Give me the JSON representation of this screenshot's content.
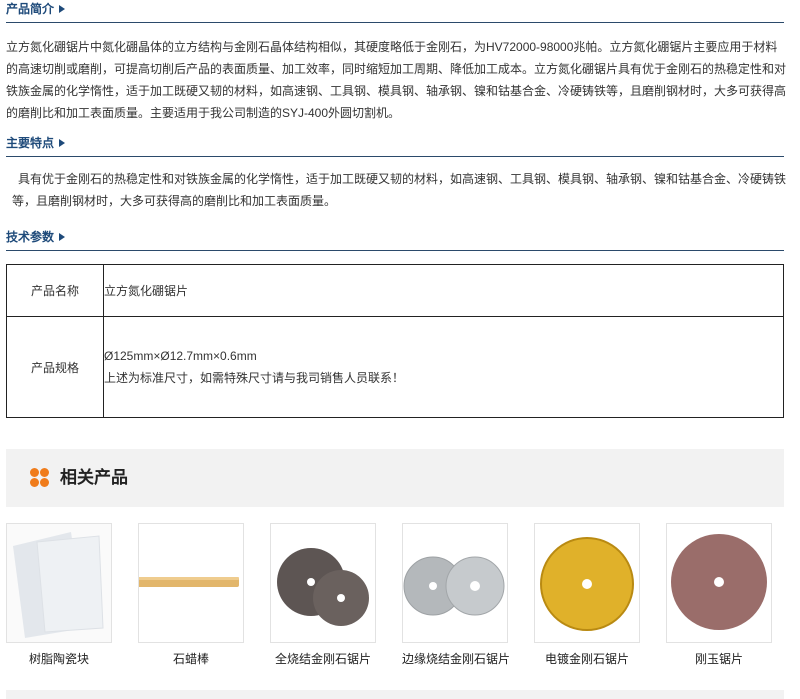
{
  "sections": {
    "intro": {
      "title": "产品简介",
      "text": "立方氮化硼锯片中氮化硼晶体的立方结构与金刚石晶体结构相似，其硬度略低于金刚石，为HV72000-98000兆帕。立方氮化硼锯片主要应用于材料的高速切削或磨削，可提高切削后产品的表面质量、加工效率，同时缩短加工周期、降低加工成本。立方氮化硼锯片具有优于金刚石的热稳定性和对铁族金属的化学惰性，适于加工既硬又韧的材料，如高速钢、工具钢、模具钢、轴承钢、镍和钴基合金、冷硬铸铁等，且磨削钢材时，大多可获得高的磨削比和加工表面质量。主要适用于我公司制造的SYJ-400外圆切割机。"
    },
    "features": {
      "title": "主要特点",
      "text": "具有优于金刚石的热稳定性和对铁族金属的化学惰性，适于加工既硬又韧的材料，如高速钢、工具钢、模具钢、轴承钢、镍和钴基合金、冷硬铸铁等，且磨削钢材时，大多可获得高的磨削比和加工表面质量。"
    },
    "params": {
      "title": "技术参数",
      "rows": [
        {
          "label": "产品名称",
          "value": "立方氮化硼锯片"
        },
        {
          "label": "产品规格",
          "value": "Ø125mm×Ø12.7mm×0.6mm",
          "note": "上述为标准尺寸，如需特殊尺寸请与我司销售人员联系！"
        }
      ]
    }
  },
  "related": {
    "title": "相关产品",
    "icon": "four-dots-icon",
    "accent": "#f07c1b",
    "items": [
      {
        "name": "树脂陶瓷块"
      },
      {
        "name": "石蜡棒"
      },
      {
        "name": "全烧结金刚石锯片"
      },
      {
        "name": "边缘烧结金刚石锯片"
      },
      {
        "name": "电镀金刚石锯片"
      },
      {
        "name": "刚玉锯片"
      }
    ]
  },
  "colors": {
    "heading": "#1e4a7a",
    "rule": "#2b4a6b",
    "panel": "#f2f2f2"
  }
}
